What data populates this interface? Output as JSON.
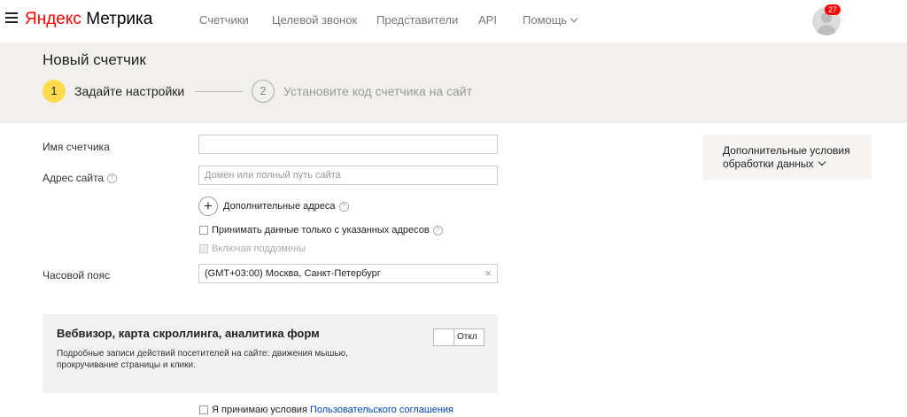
{
  "header": {
    "logo_ya": "Яндекс",
    "logo_product": "Метрика",
    "nav": [
      {
        "label": "Счетчики"
      },
      {
        "label": "Целевой звонок"
      },
      {
        "label": "Представители"
      },
      {
        "label": "API"
      },
      {
        "label": "Помощь"
      }
    ],
    "notifications_count": "27"
  },
  "page": {
    "title": "Новый счетчик",
    "steps": [
      {
        "number": "1",
        "label": "Задайте настройки",
        "active": true
      },
      {
        "number": "2",
        "label": "Установите код счетчика на сайт",
        "active": false
      }
    ]
  },
  "form": {
    "counter_name_label": "Имя счетчика",
    "counter_name_value": "",
    "site_address_label": "Адрес сайта",
    "site_address_placeholder": "Домен или полный путь сайта",
    "additional_addresses_label": "Дополнительные адреса",
    "only_specified_label": "Принимать данные только с указанных адресов",
    "include_subdomains_label": "Включая поддомены",
    "timezone_label": "Часовой пояс",
    "timezone_value": "(GMT+03:00) Москва, Санкт-Петербург"
  },
  "side_panel": {
    "label": "Дополнительные условия обработки данных"
  },
  "webvisor": {
    "title": "Вебвизор, карта скроллинга, аналитика форм",
    "description": "Подробные записи действий посетителей на сайте: движения мышью, прокручивание страницы и клики.",
    "toggle_label": "Откл",
    "enabled": false
  },
  "terms": {
    "prefix": "Я принимаю условия",
    "link": "Пользовательского соглашения"
  },
  "colors": {
    "accent_yellow": "#ffdb4d",
    "banner_bg": "#f2f0ed",
    "link_blue": "#0044bb",
    "logo_red": "#ff0000"
  }
}
